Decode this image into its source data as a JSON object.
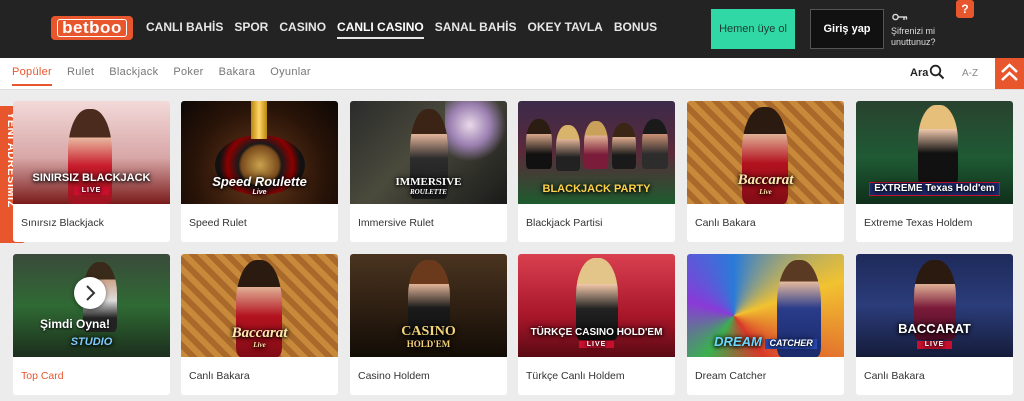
{
  "header": {
    "logo_text": "betboo",
    "nav": [
      "CANLI BAHİS",
      "SPOR",
      "CASINO",
      "CANLI CASINO",
      "SANAL BAHİS",
      "OKEY TAVLA",
      "BONUS"
    ],
    "active_nav": "CANLI CASINO",
    "register_label": "Hemen üye ol",
    "login_label": "Giriş yap",
    "forgot_line1": "Şifrenizi mi",
    "forgot_line2": "unuttunuz?",
    "help_label": "?"
  },
  "subnav": {
    "tabs": [
      "Popüler",
      "Rulet",
      "Blackjack",
      "Poker",
      "Bakara",
      "Oyunlar"
    ],
    "active_tab": "Popüler",
    "search_label": "Ara",
    "sort_label": "A-Z"
  },
  "side_tab": {
    "label": "YENİ ADRESİMİZ"
  },
  "games": [
    {
      "label": "Sınırsız Blackjack",
      "thumb_title": "SINIRSIZ BLACKJACK",
      "thumb_sub": "LIVE"
    },
    {
      "label": "Speed Rulet",
      "thumb_title": "Speed Roulette",
      "thumb_sub": "Live"
    },
    {
      "label": "Immersive Rulet",
      "thumb_title": "IMMERSIVE",
      "thumb_sub": "ROULETTE"
    },
    {
      "label": "Blackjack Partisi",
      "thumb_title": "BLACKJACK PARTY",
      "thumb_sub": ""
    },
    {
      "label": "Canlı Bakara",
      "thumb_title": "Baccarat",
      "thumb_sub": "Live"
    },
    {
      "label": "Extreme Texas Holdem",
      "thumb_title": "EXTREME Texas Hold'em",
      "thumb_sub": ""
    },
    {
      "label": "Top Card",
      "thumb_title": "STUDIO",
      "thumb_sub": ""
    },
    {
      "label": "Canlı Bakara",
      "thumb_title": "Baccarat",
      "thumb_sub": "Live"
    },
    {
      "label": "Casino Holdem",
      "thumb_title": "CASINO",
      "thumb_sub": "HOLD'EM"
    },
    {
      "label": "Türkçe Canlı Holdem",
      "thumb_title": "TÜRKÇE CASINO HOLD'EM",
      "thumb_sub": "LIVE"
    },
    {
      "label": "Dream Catcher",
      "thumb_title": "DREAM",
      "thumb_sub": "CATCHER"
    },
    {
      "label": "Canlı Bakara",
      "thumb_title": "BACCARAT",
      "thumb_sub": "LIVE"
    }
  ],
  "overlay": {
    "play_now": "Şimdi Oyna!"
  },
  "colors": {
    "accent": "#e8562e",
    "header_bg": "#232323",
    "register_bg": "#2fd8a5"
  }
}
